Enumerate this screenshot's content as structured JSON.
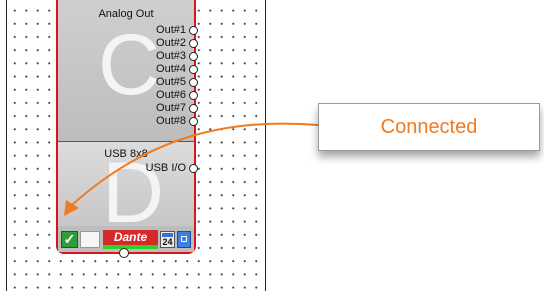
{
  "device": {
    "module_c": {
      "title": "Analog Out",
      "letter": "C",
      "ports": [
        "Out#1",
        "Out#2",
        "Out#3",
        "Out#4",
        "Out#5",
        "Out#6",
        "Out#7",
        "Out#8"
      ]
    },
    "module_d": {
      "title": "USB 8x8",
      "letter": "D",
      "ports": [
        "USB I/O"
      ]
    },
    "status": {
      "check_mark": "✓",
      "dante_label": "Dante",
      "sample_rate_label": "24"
    }
  },
  "callout": {
    "label": "Connected",
    "color": "#f07a20"
  }
}
